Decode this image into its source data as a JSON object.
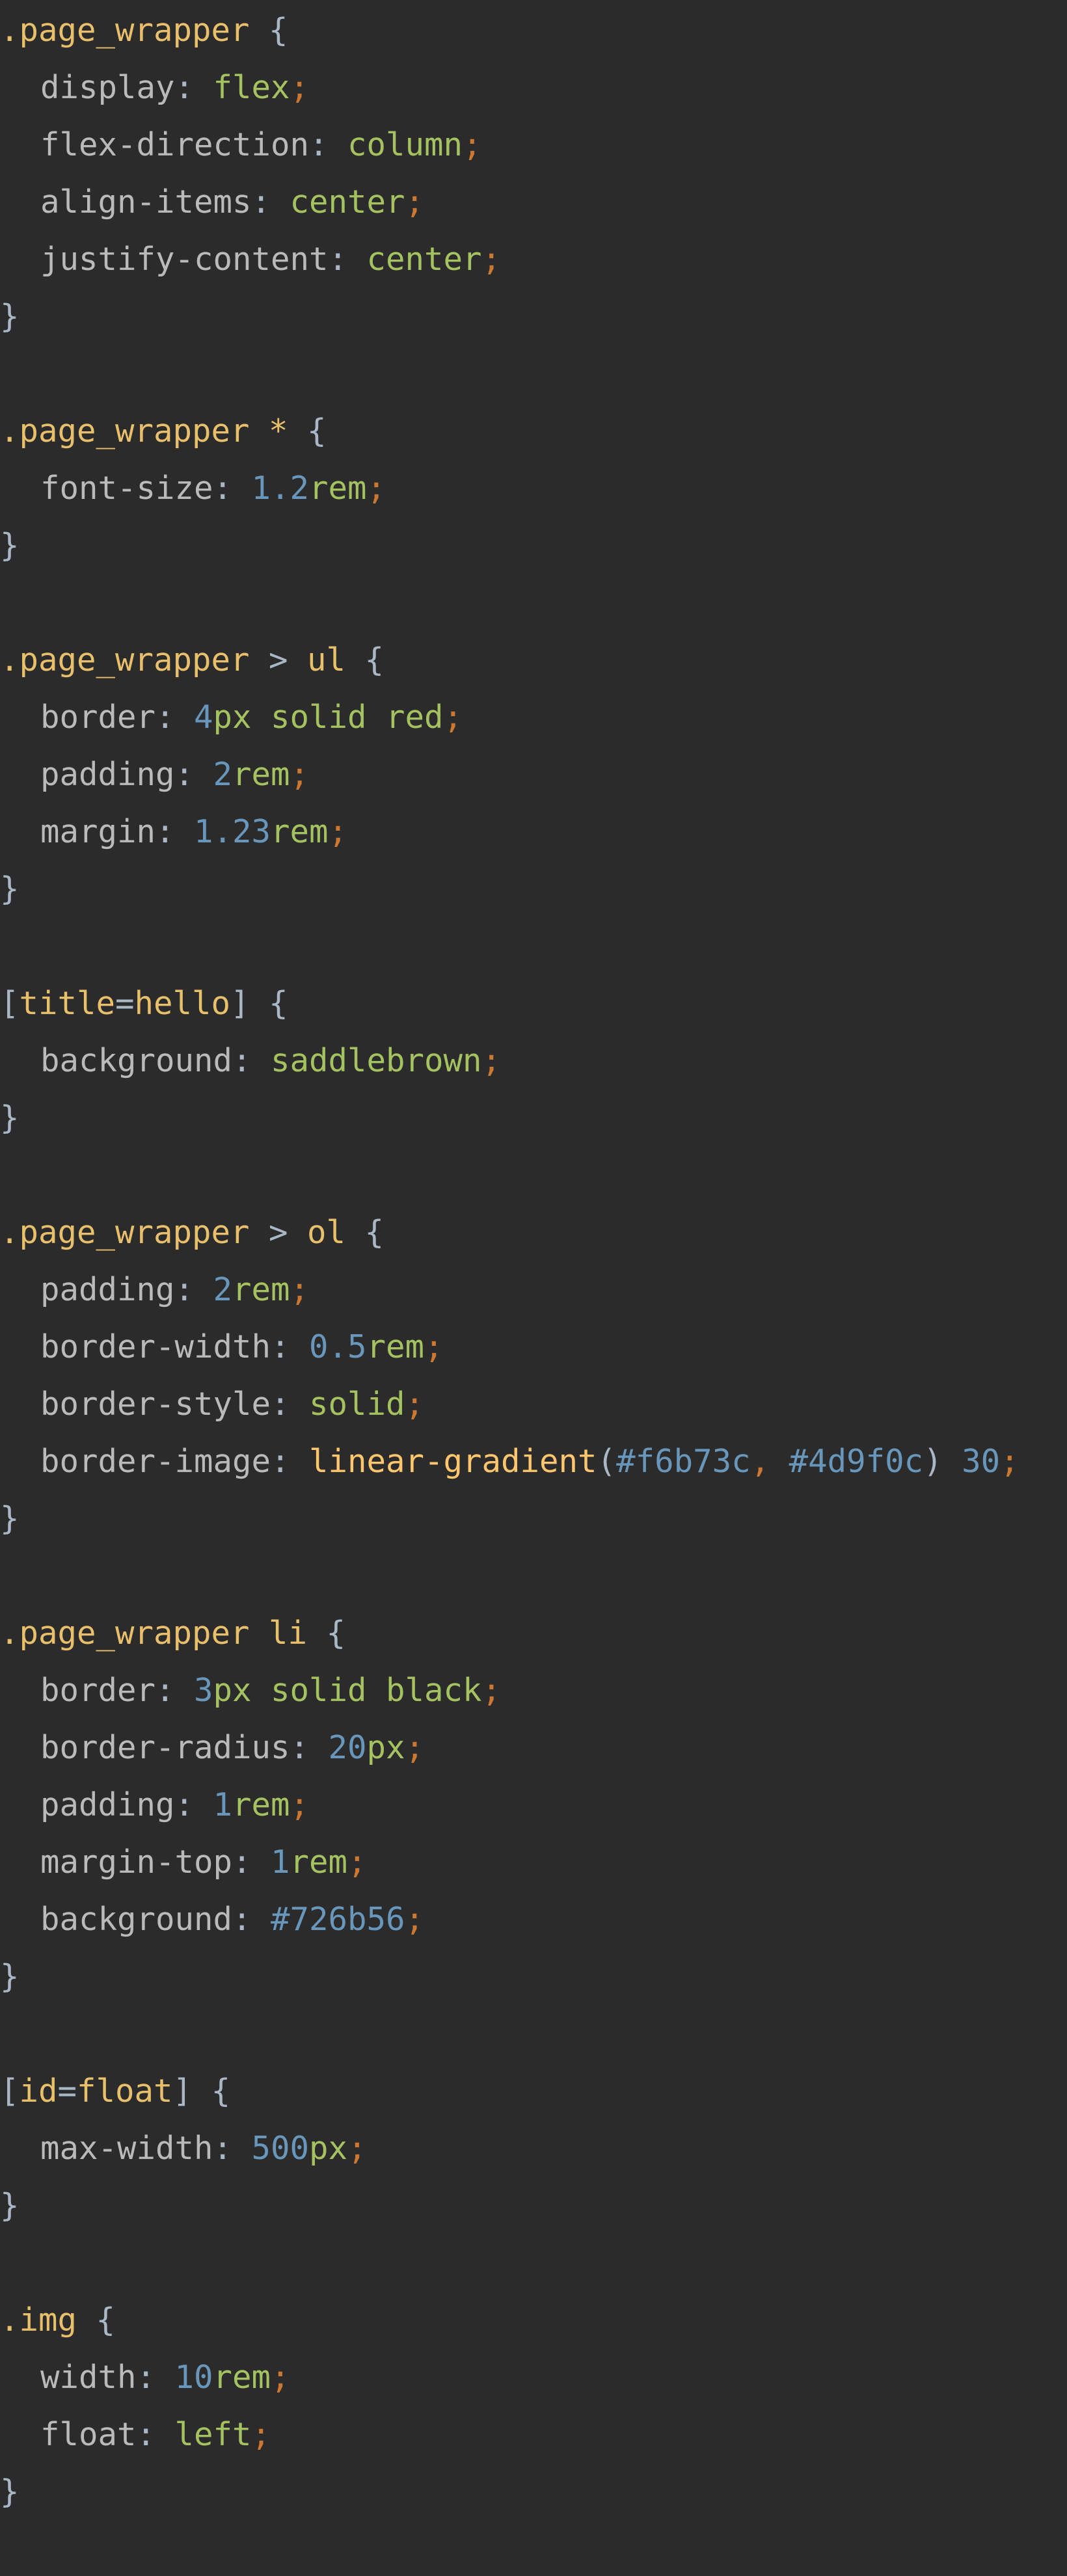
{
  "editor": {
    "language": "css",
    "theme_colors": {
      "background": "#2b2b2b",
      "default": "#a9b7c6",
      "selector": "#e8bf6a",
      "property": "#bababa",
      "value": "#a5c261",
      "number": "#6897bb",
      "semicolon": "#cc7832",
      "function": "#ffc66d"
    },
    "lines": [
      {
        "indent": 0,
        "tokens": [
          {
            "t": ".page_wrapper",
            "c": "sel"
          },
          {
            "t": " {",
            "c": "punc"
          }
        ]
      },
      {
        "indent": 1,
        "tokens": [
          {
            "t": "display",
            "c": "prop"
          },
          {
            "t": ": ",
            "c": "punc"
          },
          {
            "t": "flex",
            "c": "val"
          },
          {
            "t": ";",
            "c": "semi"
          }
        ]
      },
      {
        "indent": 1,
        "tokens": [
          {
            "t": "flex-direction",
            "c": "prop"
          },
          {
            "t": ": ",
            "c": "punc"
          },
          {
            "t": "column",
            "c": "val"
          },
          {
            "t": ";",
            "c": "semi"
          }
        ]
      },
      {
        "indent": 1,
        "tokens": [
          {
            "t": "align-items",
            "c": "prop"
          },
          {
            "t": ": ",
            "c": "punc"
          },
          {
            "t": "center",
            "c": "val"
          },
          {
            "t": ";",
            "c": "semi"
          }
        ]
      },
      {
        "indent": 1,
        "tokens": [
          {
            "t": "justify-content",
            "c": "prop"
          },
          {
            "t": ": ",
            "c": "punc"
          },
          {
            "t": "center",
            "c": "val"
          },
          {
            "t": ";",
            "c": "semi"
          }
        ]
      },
      {
        "indent": 0,
        "tokens": [
          {
            "t": "}",
            "c": "punc"
          }
        ]
      },
      {
        "indent": 0,
        "tokens": []
      },
      {
        "indent": 0,
        "tokens": [
          {
            "t": ".page_wrapper",
            "c": "sel"
          },
          {
            "t": " ",
            "c": "punc"
          },
          {
            "t": "*",
            "c": "sel"
          },
          {
            "t": " {",
            "c": "punc"
          }
        ]
      },
      {
        "indent": 1,
        "tokens": [
          {
            "t": "font-size",
            "c": "prop"
          },
          {
            "t": ": ",
            "c": "punc"
          },
          {
            "t": "1.2",
            "c": "num"
          },
          {
            "t": "rem",
            "c": "val"
          },
          {
            "t": ";",
            "c": "semi"
          }
        ]
      },
      {
        "indent": 0,
        "tokens": [
          {
            "t": "}",
            "c": "punc"
          }
        ]
      },
      {
        "indent": 0,
        "tokens": []
      },
      {
        "indent": 0,
        "tokens": [
          {
            "t": ".page_wrapper",
            "c": "sel"
          },
          {
            "t": " > ",
            "c": "punc"
          },
          {
            "t": "ul",
            "c": "sel"
          },
          {
            "t": " {",
            "c": "punc"
          }
        ]
      },
      {
        "indent": 1,
        "tokens": [
          {
            "t": "border",
            "c": "prop"
          },
          {
            "t": ": ",
            "c": "punc"
          },
          {
            "t": "4",
            "c": "num"
          },
          {
            "t": "px solid red",
            "c": "val"
          },
          {
            "t": ";",
            "c": "semi"
          }
        ]
      },
      {
        "indent": 1,
        "tokens": [
          {
            "t": "padding",
            "c": "prop"
          },
          {
            "t": ": ",
            "c": "punc"
          },
          {
            "t": "2",
            "c": "num"
          },
          {
            "t": "rem",
            "c": "val"
          },
          {
            "t": ";",
            "c": "semi"
          }
        ]
      },
      {
        "indent": 1,
        "tokens": [
          {
            "t": "margin",
            "c": "prop"
          },
          {
            "t": ": ",
            "c": "punc"
          },
          {
            "t": "1.23",
            "c": "num"
          },
          {
            "t": "rem",
            "c": "val"
          },
          {
            "t": ";",
            "c": "semi"
          }
        ]
      },
      {
        "indent": 0,
        "tokens": [
          {
            "t": "}",
            "c": "punc"
          }
        ]
      },
      {
        "indent": 0,
        "tokens": []
      },
      {
        "indent": 0,
        "tokens": [
          {
            "t": "[",
            "c": "punc"
          },
          {
            "t": "title",
            "c": "attr"
          },
          {
            "t": "=",
            "c": "punc"
          },
          {
            "t": "hello",
            "c": "attr"
          },
          {
            "t": "] {",
            "c": "punc"
          }
        ]
      },
      {
        "indent": 1,
        "tokens": [
          {
            "t": "background",
            "c": "prop"
          },
          {
            "t": ": ",
            "c": "punc"
          },
          {
            "t": "saddlebrown",
            "c": "val"
          },
          {
            "t": ";",
            "c": "semi"
          }
        ]
      },
      {
        "indent": 0,
        "tokens": [
          {
            "t": "}",
            "c": "punc"
          }
        ]
      },
      {
        "indent": 0,
        "tokens": []
      },
      {
        "indent": 0,
        "tokens": [
          {
            "t": ".page_wrapper",
            "c": "sel"
          },
          {
            "t": " > ",
            "c": "punc"
          },
          {
            "t": "ol",
            "c": "sel"
          },
          {
            "t": " {",
            "c": "punc"
          }
        ]
      },
      {
        "indent": 1,
        "tokens": [
          {
            "t": "padding",
            "c": "prop"
          },
          {
            "t": ": ",
            "c": "punc"
          },
          {
            "t": "2",
            "c": "num"
          },
          {
            "t": "rem",
            "c": "val"
          },
          {
            "t": ";",
            "c": "semi"
          }
        ]
      },
      {
        "indent": 1,
        "tokens": [
          {
            "t": "border-width",
            "c": "prop"
          },
          {
            "t": ": ",
            "c": "punc"
          },
          {
            "t": "0.5",
            "c": "num"
          },
          {
            "t": "rem",
            "c": "val"
          },
          {
            "t": ";",
            "c": "semi"
          }
        ]
      },
      {
        "indent": 1,
        "tokens": [
          {
            "t": "border-style",
            "c": "prop"
          },
          {
            "t": ": ",
            "c": "punc"
          },
          {
            "t": "solid",
            "c": "val"
          },
          {
            "t": ";",
            "c": "semi"
          }
        ]
      },
      {
        "indent": 1,
        "tokens": [
          {
            "t": "border-image",
            "c": "prop"
          },
          {
            "t": ": ",
            "c": "punc"
          },
          {
            "t": "linear-gradient",
            "c": "fn"
          },
          {
            "t": "(",
            "c": "punc"
          },
          {
            "t": "#f6b73c",
            "c": "num"
          },
          {
            "t": ", ",
            "c": "semi"
          },
          {
            "t": "#4d9f0c",
            "c": "num"
          },
          {
            "t": ") ",
            "c": "punc"
          },
          {
            "t": "30",
            "c": "num"
          },
          {
            "t": ";",
            "c": "semi"
          }
        ]
      },
      {
        "indent": 0,
        "tokens": [
          {
            "t": "}",
            "c": "punc"
          }
        ]
      },
      {
        "indent": 0,
        "tokens": []
      },
      {
        "indent": 0,
        "tokens": [
          {
            "t": ".page_wrapper",
            "c": "sel"
          },
          {
            "t": " ",
            "c": "punc"
          },
          {
            "t": "li",
            "c": "sel"
          },
          {
            "t": " {",
            "c": "punc"
          }
        ]
      },
      {
        "indent": 1,
        "tokens": [
          {
            "t": "border",
            "c": "prop"
          },
          {
            "t": ": ",
            "c": "punc"
          },
          {
            "t": "3",
            "c": "num"
          },
          {
            "t": "px solid black",
            "c": "val"
          },
          {
            "t": ";",
            "c": "semi"
          }
        ]
      },
      {
        "indent": 1,
        "tokens": [
          {
            "t": "border-radius",
            "c": "prop"
          },
          {
            "t": ": ",
            "c": "punc"
          },
          {
            "t": "20",
            "c": "num"
          },
          {
            "t": "px",
            "c": "val"
          },
          {
            "t": ";",
            "c": "semi"
          }
        ]
      },
      {
        "indent": 1,
        "tokens": [
          {
            "t": "padding",
            "c": "prop"
          },
          {
            "t": ": ",
            "c": "punc"
          },
          {
            "t": "1",
            "c": "num"
          },
          {
            "t": "rem",
            "c": "val"
          },
          {
            "t": ";",
            "c": "semi"
          }
        ]
      },
      {
        "indent": 1,
        "tokens": [
          {
            "t": "margin-top",
            "c": "prop"
          },
          {
            "t": ": ",
            "c": "punc"
          },
          {
            "t": "1",
            "c": "num"
          },
          {
            "t": "rem",
            "c": "val"
          },
          {
            "t": ";",
            "c": "semi"
          }
        ]
      },
      {
        "indent": 1,
        "tokens": [
          {
            "t": "background",
            "c": "prop"
          },
          {
            "t": ": ",
            "c": "punc"
          },
          {
            "t": "#726b56",
            "c": "num"
          },
          {
            "t": ";",
            "c": "semi"
          }
        ]
      },
      {
        "indent": 0,
        "tokens": [
          {
            "t": "}",
            "c": "punc"
          }
        ]
      },
      {
        "indent": 0,
        "tokens": []
      },
      {
        "indent": 0,
        "tokens": [
          {
            "t": "[",
            "c": "punc"
          },
          {
            "t": "id",
            "c": "attr"
          },
          {
            "t": "=",
            "c": "punc"
          },
          {
            "t": "float",
            "c": "attr"
          },
          {
            "t": "] {",
            "c": "punc"
          }
        ]
      },
      {
        "indent": 1,
        "tokens": [
          {
            "t": "max-width",
            "c": "prop"
          },
          {
            "t": ": ",
            "c": "punc"
          },
          {
            "t": "500",
            "c": "num"
          },
          {
            "t": "px",
            "c": "val"
          },
          {
            "t": ";",
            "c": "semi"
          }
        ]
      },
      {
        "indent": 0,
        "tokens": [
          {
            "t": "}",
            "c": "punc"
          }
        ]
      },
      {
        "indent": 0,
        "tokens": []
      },
      {
        "indent": 0,
        "tokens": [
          {
            "t": ".img",
            "c": "sel"
          },
          {
            "t": " {",
            "c": "punc"
          }
        ]
      },
      {
        "indent": 1,
        "tokens": [
          {
            "t": "width",
            "c": "prop"
          },
          {
            "t": ": ",
            "c": "punc"
          },
          {
            "t": "10",
            "c": "num"
          },
          {
            "t": "rem",
            "c": "val"
          },
          {
            "t": ";",
            "c": "semi"
          }
        ]
      },
      {
        "indent": 1,
        "tokens": [
          {
            "t": "float",
            "c": "prop"
          },
          {
            "t": ": ",
            "c": "punc"
          },
          {
            "t": "left",
            "c": "val"
          },
          {
            "t": ";",
            "c": "semi"
          }
        ]
      },
      {
        "indent": 0,
        "tokens": [
          {
            "t": "}",
            "c": "punc"
          }
        ]
      }
    ]
  }
}
